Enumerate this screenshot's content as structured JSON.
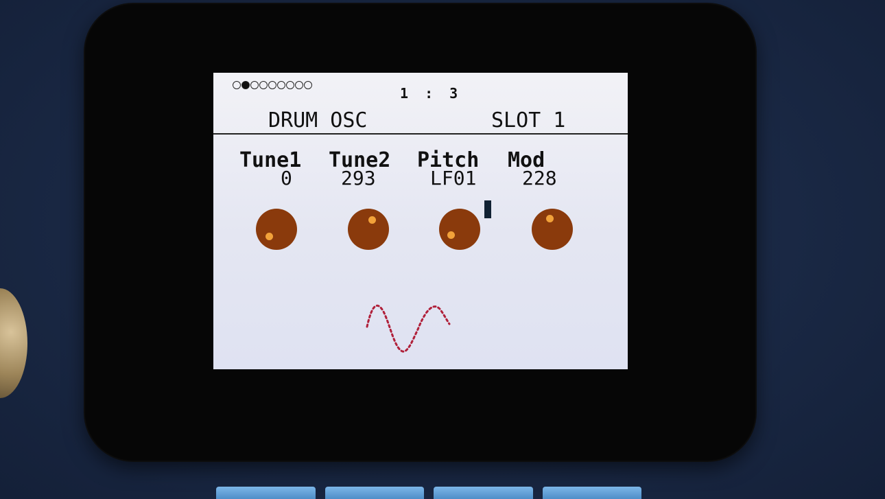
{
  "header": {
    "page_indicator": {
      "total": 9,
      "active_index": 1
    },
    "position": "1 : 3",
    "title": "DRUM OSC",
    "slot": "SLOT 1"
  },
  "params": [
    {
      "name": "Tune1",
      "value": "0",
      "knob_angle_deg": 220
    },
    {
      "name": "Tune2",
      "value": "293",
      "knob_angle_deg": 320
    },
    {
      "name": "Pitch",
      "value": "LF01",
      "knob_angle_deg": 225
    },
    {
      "name": "Mod",
      "value": "228",
      "knob_angle_deg": 300
    }
  ],
  "waveform": {
    "shape": "sine",
    "color": "#b0203a"
  },
  "colors": {
    "knob": "#8a3a0c",
    "knob_pointer": "#f2a23a",
    "screen_bg": "#e8e9f2"
  }
}
